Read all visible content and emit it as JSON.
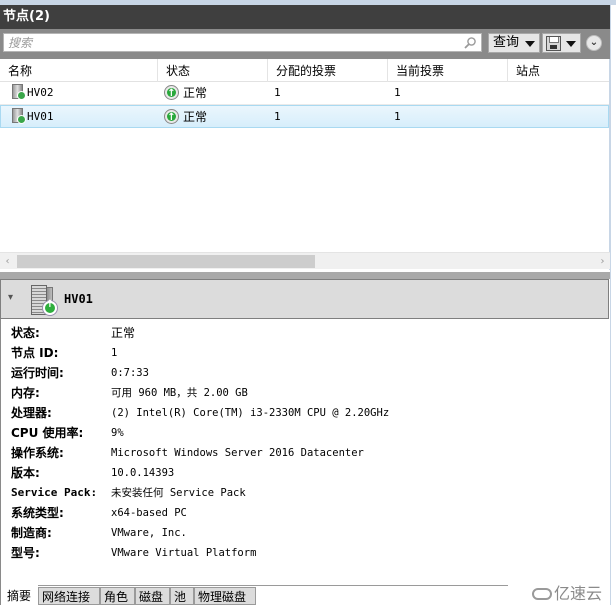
{
  "panel": {
    "title": "节点(2)"
  },
  "toolbar": {
    "search_placeholder": "搜索",
    "query_label": "查询",
    "search_icon": "search-icon",
    "save_icon": "save-icon",
    "expand_icon": "chevron-down-circle-icon"
  },
  "grid": {
    "columns": [
      "名称",
      "状态",
      "分配的投票",
      "当前投票",
      "站点"
    ],
    "rows": [
      {
        "name": "HV02",
        "status": "正常",
        "assigned_votes": "1",
        "current_votes": "1",
        "site": "",
        "selected": false
      },
      {
        "name": "HV01",
        "status": "正常",
        "assigned_votes": "1",
        "current_votes": "1",
        "site": "",
        "selected": true
      }
    ]
  },
  "detail": {
    "title": "HV01",
    "properties": [
      {
        "label": "状态:",
        "value": "正常"
      },
      {
        "label": "节点 ID:",
        "value": "1"
      },
      {
        "label": "运行时间:",
        "value": "0:7:33"
      },
      {
        "label": "内存:",
        "value": "可用 960 MB，共 2.00 GB"
      },
      {
        "label": "处理器:",
        "value": "(2) Intel(R) Core(TM) i3-2330M CPU @ 2.20GHz"
      },
      {
        "label": "CPU 使用率:",
        "value": "9%"
      },
      {
        "label": "操作系统:",
        "value": "Microsoft Windows Server 2016 Datacenter"
      },
      {
        "label": "版本:",
        "value": "10.0.14393"
      },
      {
        "label": "Service Pack:",
        "value": "未安装任何 Service Pack"
      },
      {
        "label": "系统类型:",
        "value": "x64-based PC"
      },
      {
        "label": "制造商:",
        "value": "VMware, Inc."
      },
      {
        "label": "型号:",
        "value": "VMware Virtual Platform"
      }
    ]
  },
  "tabs": [
    {
      "label": "摘要",
      "active": true
    },
    {
      "label": "网络连接",
      "active": false
    },
    {
      "label": "角色",
      "active": false
    },
    {
      "label": "磁盘",
      "active": false
    },
    {
      "label": "池",
      "active": false
    },
    {
      "label": "物理磁盘",
      "active": false
    }
  ],
  "watermark": "亿速云"
}
